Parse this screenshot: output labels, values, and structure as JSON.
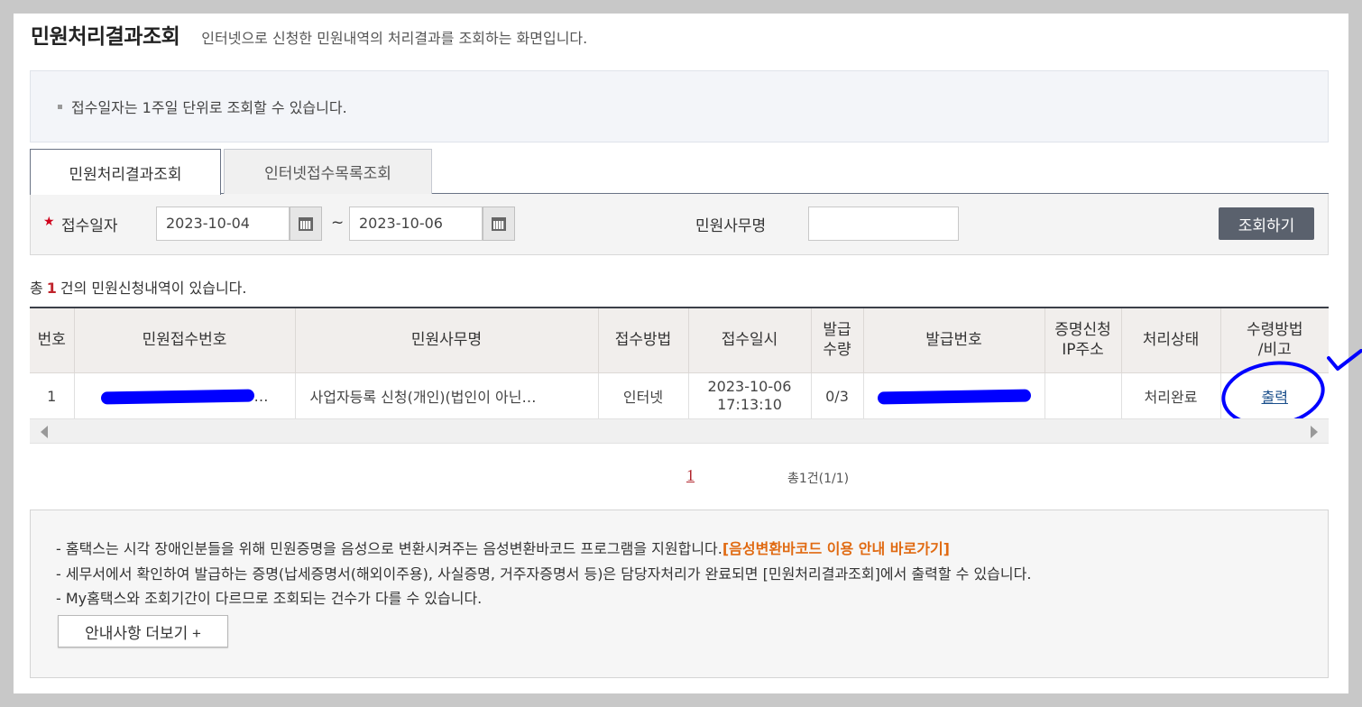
{
  "header": {
    "title": "민원처리결과조회",
    "description": "인터넷으로 신청한 민원내역의 처리결과를 조회하는 화면입니다."
  },
  "notice": {
    "text": "접수일자는 1주일 단위로 조회할 수 있습니다."
  },
  "tabs": [
    {
      "label": "민원처리결과조회",
      "active": true
    },
    {
      "label": "인터넷접수목록조회",
      "active": false
    }
  ],
  "search": {
    "date_label": "접수일자",
    "start_date": "2023-10-04",
    "tilde": "~",
    "end_date": "2023-10-06",
    "name_label": "민원사무명",
    "name_value": "",
    "button_label": "조회하기"
  },
  "result_count": {
    "prefix": "총",
    "count": "1",
    "suffix": "건의 민원신청내역이 있습니다."
  },
  "table": {
    "headers": {
      "no": "번호",
      "receipt_no": "민원접수번호",
      "name": "민원사무명",
      "method": "접수방법",
      "datetime": "접수일시",
      "qty_line1": "발급",
      "qty_line2": "수량",
      "issue_no": "발급번호",
      "ip_line1": "증명신청",
      "ip_line2": "IP주소",
      "status": "처리상태",
      "receive_line1": "수령방법",
      "receive_line2": "/비고"
    },
    "rows": [
      {
        "no": "1",
        "receipt_no_tail": "…",
        "name": "사업자등록 신청(개인)(법인이 아닌…",
        "method": "인터넷",
        "date": "2023-10-06",
        "time": "17:13:10",
        "qty": "0/3",
        "issue_no": "",
        "ip": "",
        "status": "처리완료",
        "action": "출력"
      }
    ]
  },
  "pagination": {
    "current": "1",
    "total": "총1건(1/1)"
  },
  "info": {
    "line1": "- 홈택스는 시각 장애인분들을 위해 민원증명을 음성으로 변환시켜주는 음성변환바코드 프로그램을 지원합니다.",
    "line1_link": "[음성변환바코드 이용 안내 바로가기]",
    "line2": "- 세무서에서 확인하여 발급하는 증명(납세증명서(해외이주용), 사실증명, 거주자증명서 등)은 담당자처리가 완료되면 [민원처리결과조회]에서 출력할 수 있습니다.",
    "line3": "- My홈택스와 조회기간이 다르므로 조회되는 건수가 다를 수 있습니다.",
    "more_button": "안내사항 더보기 +"
  },
  "colors": {
    "search_button": "#5a616d",
    "accent_red": "#c0242c",
    "link_orange": "#e06a12",
    "annotation_blue": "#0000ff"
  }
}
